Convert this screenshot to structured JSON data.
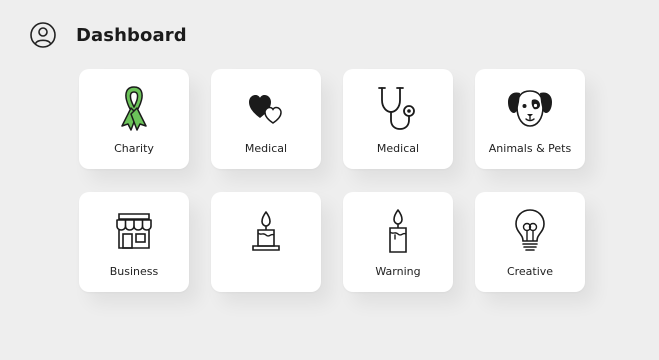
{
  "header": {
    "title": "Dashboard",
    "avatar_icon": "user-circle-icon"
  },
  "cards": [
    {
      "label": "Charity",
      "icon": "awareness-ribbon-icon",
      "accent": "#6cc35a"
    },
    {
      "label": "Medical",
      "icon": "hearts-icon"
    },
    {
      "label": "Medical",
      "icon": "stethoscope-icon"
    },
    {
      "label": "Animals & Pets",
      "icon": "dog-face-icon"
    },
    {
      "label": "Business",
      "icon": "storefront-icon"
    },
    {
      "label": "",
      "icon": "candle-icon"
    },
    {
      "label": "Warning",
      "icon": "candle-icon"
    },
    {
      "label": "Creative",
      "icon": "lightbulb-icon"
    }
  ]
}
